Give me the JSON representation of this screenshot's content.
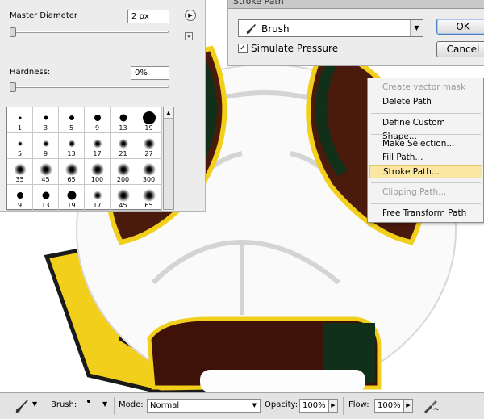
{
  "brush_panel": {
    "master_diameter_label": "Master Diameter",
    "master_diameter_value": "2 px",
    "hardness_label": "Hardness:",
    "hardness_value": "0%",
    "presets": [
      {
        "size": "1",
        "soft": false
      },
      {
        "size": "3",
        "soft": false
      },
      {
        "size": "5",
        "soft": false
      },
      {
        "size": "9",
        "soft": false
      },
      {
        "size": "13",
        "soft": false
      },
      {
        "size": "19",
        "soft": false
      },
      {
        "size": "5",
        "soft": true
      },
      {
        "size": "9",
        "soft": true
      },
      {
        "size": "13",
        "soft": true
      },
      {
        "size": "17",
        "soft": true
      },
      {
        "size": "21",
        "soft": true
      },
      {
        "size": "27",
        "soft": true
      },
      {
        "size": "35",
        "soft": true
      },
      {
        "size": "45",
        "soft": true
      },
      {
        "size": "65",
        "soft": true
      },
      {
        "size": "100",
        "soft": true
      },
      {
        "size": "200",
        "soft": true
      },
      {
        "size": "300",
        "soft": true
      },
      {
        "size": "9",
        "soft": false
      },
      {
        "size": "13",
        "soft": false
      },
      {
        "size": "19",
        "soft": false
      },
      {
        "size": "17",
        "soft": true
      },
      {
        "size": "45",
        "soft": true
      },
      {
        "size": "65",
        "soft": true
      }
    ]
  },
  "stroke_dialog": {
    "title": "Stroke Path",
    "tool_value": "Brush",
    "simulate_pressure_label": "Simulate Pressure",
    "simulate_pressure_checked": true,
    "ok_label": "OK",
    "cancel_label": "Cancel"
  },
  "context_menu": {
    "items": [
      {
        "label": "Create vector mask",
        "disabled": true
      },
      {
        "label": "Delete Path",
        "disabled": false
      },
      {
        "label": "Define Custom Shape...",
        "disabled": false
      },
      {
        "label": "Make Selection...",
        "disabled": false
      },
      {
        "label": "Fill Path...",
        "disabled": false
      },
      {
        "label": "Stroke Path...",
        "disabled": false,
        "highlighted": true
      },
      {
        "label": "Clipping Path...",
        "disabled": true
      },
      {
        "label": "Free Transform Path",
        "disabled": false
      }
    ]
  },
  "options_bar": {
    "brush_label": "Brush:",
    "mode_label": "Mode:",
    "mode_value": "Normal",
    "opacity_label": "Opacity:",
    "opacity_value": "100%",
    "flow_label": "Flow:",
    "flow_value": "100%"
  },
  "colors": {
    "ball_dark_red": "#4a1a0c",
    "ball_dark_green": "#11301a",
    "ball_yellow": "#f2cf1a",
    "menu_highlight": "#fbe7a1"
  }
}
